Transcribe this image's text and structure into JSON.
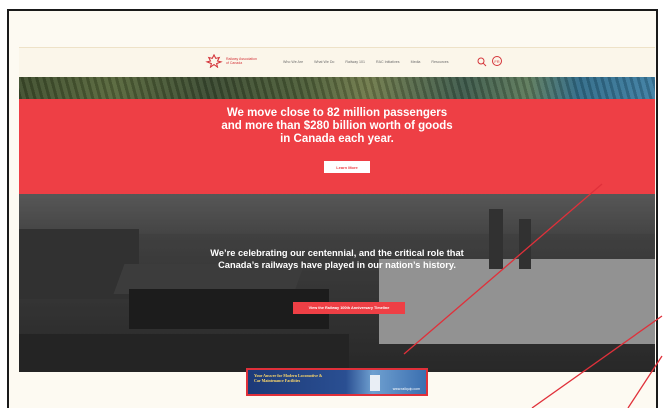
{
  "header": {
    "logo_line1": "Railway Association",
    "logo_line2": "of Canada",
    "nav": [
      "Who We Are",
      "What We Do",
      "Railway 101",
      "RAC Initiatives",
      "Media",
      "Resources"
    ],
    "lang_label": "FR"
  },
  "hero": {
    "headline": "We move close to 82 million passengers and more than $280 billion worth of goods in Canada each year.",
    "button_label": "Learn More"
  },
  "centennial": {
    "text": "We’re celebrating our centennial, and the critical role that Canada’s railways have played in our nation’s history.",
    "button_label": "View the Railway 100th Anniversary Timeline"
  },
  "ad": {
    "line1": "Your Answer for Modern Locomotive &",
    "line2": "Car Maintenance Facilities",
    "url": "www.railquip.com"
  },
  "colors": {
    "accent": "#ee3f45",
    "header_bg": "#fbf6ea",
    "annotation": "#e0303a"
  }
}
